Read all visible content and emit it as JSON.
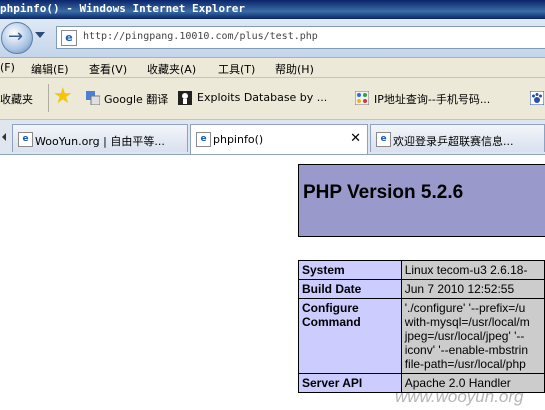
{
  "window": {
    "title": "phpinfo() - Windows Internet Explorer"
  },
  "address_bar": {
    "url": "http://pingpang.10010.com/plus/test.php"
  },
  "menu": [
    "(F)",
    "编辑(E)",
    "查看(V)",
    "收藏夹(A)",
    "工具(T)",
    "帮助(H)"
  ],
  "favorites": {
    "label": "收藏夹",
    "items": [
      "Google 翻译",
      "Exploits Database by ...",
      "IP地址查询--手机号码..."
    ]
  },
  "tabs": [
    {
      "label": "WooYun.org | 自由平等..."
    },
    {
      "label": "phpinfo()",
      "active": true
    },
    {
      "label": "欢迎登录乒超联赛信息..."
    }
  ],
  "php": {
    "version_title": "PHP Version 5.2.6",
    "rows": [
      {
        "key": "System",
        "value": [
          "Linux tecom-u3 2.6.18-"
        ]
      },
      {
        "key": "Build Date",
        "value": [
          "Jun 7 2010 12:52:55"
        ]
      },
      {
        "key": "Configure Command",
        "value": [
          "'./configure' '--prefix=/u",
          "with-mysql=/usr/local/m",
          "jpeg=/usr/local/jpeg' '--",
          "iconv' '--enable-mbstrin",
          "file-path=/usr/local/php"
        ]
      },
      {
        "key": "Server API",
        "value": [
          "Apache 2.0 Handler"
        ]
      }
    ]
  },
  "watermark": "www.wooyun.org"
}
